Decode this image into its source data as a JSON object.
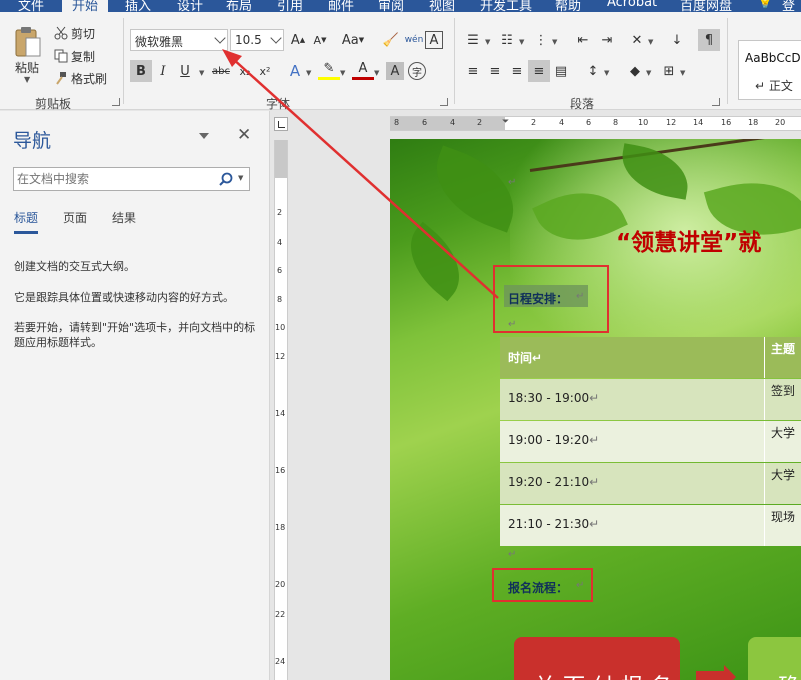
{
  "tabs": [
    "文件",
    "开始",
    "插入",
    "设计",
    "布局",
    "引用",
    "邮件",
    "审阅",
    "视图",
    "开发工具",
    "帮助",
    "Acrobat",
    "百度网盘",
    "登"
  ],
  "ribbon": {
    "clipboard": {
      "paste": "粘贴",
      "cut": "剪切",
      "copy": "复制",
      "format_painter": "格式刷",
      "label": "剪贴板"
    },
    "font": {
      "font_name": "微软雅黑",
      "font_size": "10.5",
      "grow": "A",
      "shrink": "A",
      "change_case": "Aa",
      "bold": "B",
      "italic": "I",
      "underline": "U",
      "strikethrough": "abc",
      "subscript": "x₂",
      "superscript": "x²",
      "phonetic": "wén",
      "border_char": "A",
      "shading_char": "A",
      "enclose_char": "字",
      "label": "字体"
    },
    "paragraph": {
      "label": "段落"
    },
    "styles": {
      "sample": "AaBbCcDd",
      "name": "↵ 正文"
    }
  },
  "nav": {
    "title": "导航",
    "search_placeholder": "在文档中搜索",
    "tabs": [
      "标题",
      "页面",
      "结果"
    ],
    "text1": "创建文档的交互式大纲。",
    "text2": "它是跟踪具体位置或快速移动内容的好方式。",
    "text3": "若要开始，请转到\"开始\"选项卡，并向文档中的标题应用标题样式。"
  },
  "ruler": {
    "h": [
      "8",
      "6",
      "4",
      "2",
      "",
      "2",
      "4",
      "6",
      "8",
      "10",
      "12",
      "14",
      "16",
      "18",
      "20"
    ],
    "v": [
      "2",
      "4",
      "6",
      "8",
      "10",
      "12",
      "14",
      "16",
      "18",
      "20",
      "22",
      "24"
    ]
  },
  "doc": {
    "headline": "“领慧讲堂”就",
    "schedule_label": "日程安排：",
    "table_headers": [
      "时间",
      "主题"
    ],
    "rows": [
      {
        "time": "18:30 - 19:00",
        "topic": "签到"
      },
      {
        "time": "19:00 - 19:20",
        "topic": "大学"
      },
      {
        "time": "19:20 - 21:10",
        "topic": "大学"
      },
      {
        "time": "21:10 - 21:30",
        "topic": "现场"
      }
    ],
    "signup_label": "报名流程：",
    "cta1": "关 而 付 报 名",
    "cta2": "确",
    "para_mark": "↵"
  },
  "colors": {
    "accent": "#2b579a",
    "annotation": "#e03030",
    "headline": "#c00000",
    "table_header": "#9bbb59"
  }
}
